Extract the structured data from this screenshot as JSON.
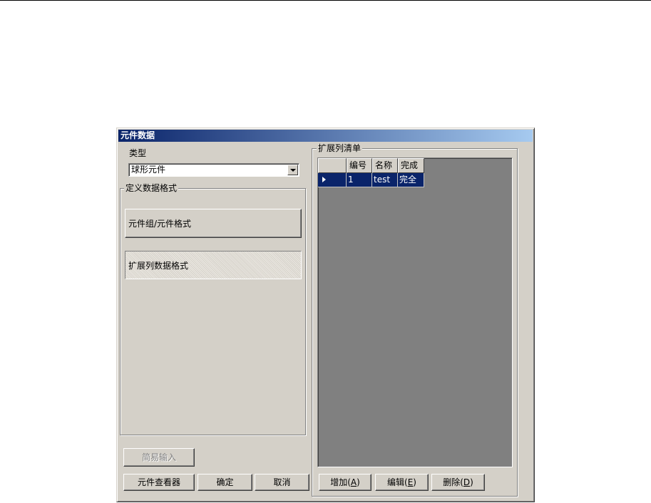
{
  "dialog": {
    "title": "元件数据",
    "type_label": "类型",
    "type_combo": {
      "selected": "球形元件"
    },
    "define_group": {
      "title": "定义数据格式",
      "buttons": [
        {
          "label": "元件组/元件格式"
        },
        {
          "label": "扩展列数据格式"
        }
      ]
    },
    "ext_group": {
      "title": "扩展列清单",
      "columns": [
        "编号",
        "名称",
        "完成"
      ],
      "rows": [
        {
          "id": "1",
          "name": "test",
          "status": "完全"
        }
      ],
      "buttons": {
        "add": {
          "text": "增加(",
          "key": "A",
          "end": ")"
        },
        "edit": {
          "text": "编辑(",
          "key": "E",
          "end": ")"
        },
        "delete": {
          "text": "删除(",
          "key": "D",
          "end": ")"
        }
      }
    },
    "left_buttons": {
      "simple_input": "简易输入",
      "viewer": "元件查看器",
      "ok": "确定",
      "cancel": "取消"
    }
  }
}
